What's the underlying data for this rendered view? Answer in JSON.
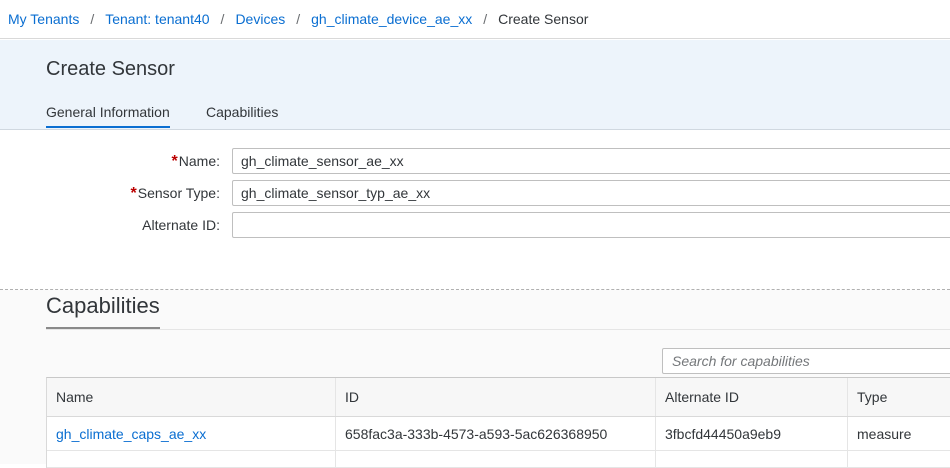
{
  "breadcrumb": {
    "items": [
      {
        "label": "My Tenants"
      },
      {
        "label": "Tenant: tenant40"
      },
      {
        "label": "Devices"
      },
      {
        "label": "gh_climate_device_ae_xx"
      }
    ],
    "separator": "/",
    "current": "Create Sensor"
  },
  "header": {
    "title": "Create Sensor",
    "tabs": [
      {
        "label": "General Information",
        "active": true
      },
      {
        "label": "Capabilities",
        "active": false
      }
    ]
  },
  "form": {
    "required_mark": "*",
    "name": {
      "label": "Name:",
      "value": "gh_climate_sensor_ae_xx",
      "required": true
    },
    "sensor_type": {
      "label": "Sensor Type:",
      "value": "gh_climate_sensor_typ_ae_xx",
      "required": true
    },
    "alternate_id": {
      "label": "Alternate ID:",
      "value": "",
      "required": false
    }
  },
  "capabilities": {
    "title": "Capabilities",
    "search": {
      "placeholder": "Search for capabilities",
      "value": ""
    },
    "columns": [
      "Name",
      "ID",
      "Alternate ID",
      "Type"
    ],
    "rows": [
      {
        "name": "gh_climate_caps_ae_xx",
        "id": "658fac3a-333b-4573-a593-5ac626368950",
        "alternate_id": "3fbcfd44450a9eb9",
        "type": "measure"
      }
    ]
  },
  "colors": {
    "link": "#0a6ed1",
    "required": "#bb0000",
    "header_bg": "#edf4fb",
    "section_bg": "#fafafa"
  }
}
